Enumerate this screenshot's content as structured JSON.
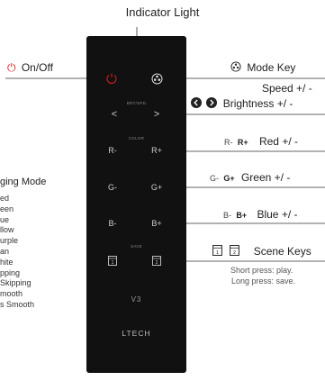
{
  "indicator_label": "Indicator Light",
  "on_off": {
    "icon": "power-icon",
    "label": "On/Off",
    "accent": "#e02020"
  },
  "mode_key": {
    "icon": "mode-icon",
    "label": "Mode Key"
  },
  "speed": {
    "label": "Speed",
    "suffix": "+/ -"
  },
  "brightness": {
    "label": "Brightness",
    "suffix": "+/ -"
  },
  "red": {
    "minus": "R-",
    "plus": "R+",
    "label": "Red",
    "suffix": "+/ -"
  },
  "green": {
    "minus": "G-",
    "plus": "G+",
    "label": "Green",
    "suffix": "+/ -"
  },
  "blue": {
    "minus": "B-",
    "plus": "B+",
    "label": "Blue",
    "suffix": "+/ -"
  },
  "scene_keys": {
    "label": "Scene Keys",
    "short_press": "Short press: play.",
    "long_press": "Long press: save.",
    "key1": "1",
    "key2": "2"
  },
  "remote": {
    "brt_spd": "BRT/SPD",
    "color": "COLOR",
    "save": "SAVE",
    "left_arrow": "<",
    "right_arrow": ">",
    "model": "V3",
    "brand": "LTECH"
  },
  "changing_mode": {
    "title": "ging Mode",
    "items": [
      "ed",
      "een",
      "ue",
      "llow",
      "urple",
      "an",
      "hite",
      "pping",
      " Skipping",
      "mooth",
      "s Smooth"
    ]
  }
}
